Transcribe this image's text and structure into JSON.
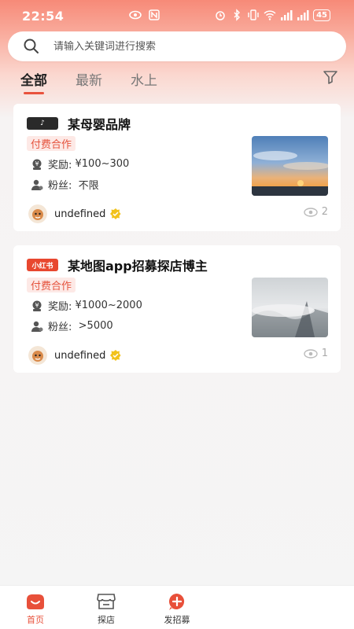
{
  "status_bar": {
    "time": "22:54",
    "battery": "45"
  },
  "search": {
    "placeholder": "请输入关键词进行搜索"
  },
  "tabs": [
    {
      "label": "全部",
      "active": true
    },
    {
      "label": "最新",
      "active": false
    },
    {
      "label": "水上",
      "active": false
    }
  ],
  "cards": [
    {
      "platform_badge": "♪",
      "platform_icon": "douyin-icon",
      "title": "某母婴品牌",
      "tag": "付费合作",
      "reward_label": "奖励: ",
      "reward_value": "¥100~300",
      "fans_label": "粉丝:  ",
      "fans_value": "不限",
      "author": "undefined",
      "views": "2",
      "image": "sunset-sky-photo"
    },
    {
      "platform_badge": "小红书",
      "platform_icon": "xiaohongshu-icon",
      "title": "某地图app招募探店博主",
      "tag": "付费合作",
      "reward_label": "奖励: ",
      "reward_value": "¥1000~2000",
      "fans_label": "粉丝:  ",
      "fans_value": ">5000",
      "author": "undefined",
      "views": "1",
      "image": "foggy-mountain-photo"
    }
  ],
  "bottom_nav": [
    {
      "label": "首页",
      "icon": "home-icon",
      "active": true
    },
    {
      "label": "探店",
      "icon": "store-icon",
      "active": false
    },
    {
      "label": "发招募",
      "icon": "post-recruit-icon",
      "active": false
    }
  ],
  "colors": {
    "accent": "#e9523d",
    "tag_bg": "#fde9e6",
    "badge_douyin": "#2a2a2a",
    "badge_xhs": "#e8472f"
  }
}
